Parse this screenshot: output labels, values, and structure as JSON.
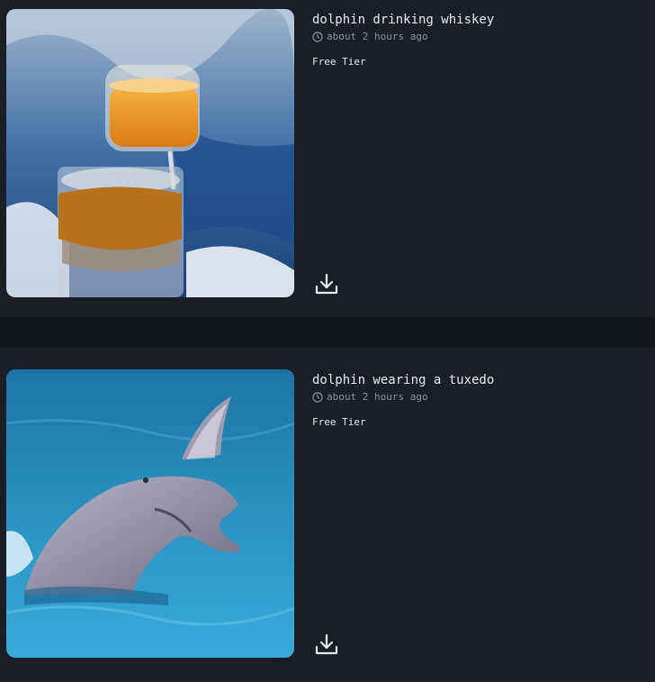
{
  "posts": [
    {
      "title": "dolphin drinking whiskey",
      "time": "about 2 hours ago",
      "tier": "Free Tier",
      "image_icon": "generated-image",
      "download_icon": "download-icon"
    },
    {
      "title": "dolphin wearing a tuxedo",
      "time": "about 2 hours ago",
      "tier": "Free Tier",
      "image_icon": "generated-image",
      "download_icon": "download-icon"
    }
  ],
  "colors": {
    "background": "#15181d",
    "card": "#1b1e25",
    "text": "#e8e9ec",
    "muted": "#8a8f99"
  }
}
